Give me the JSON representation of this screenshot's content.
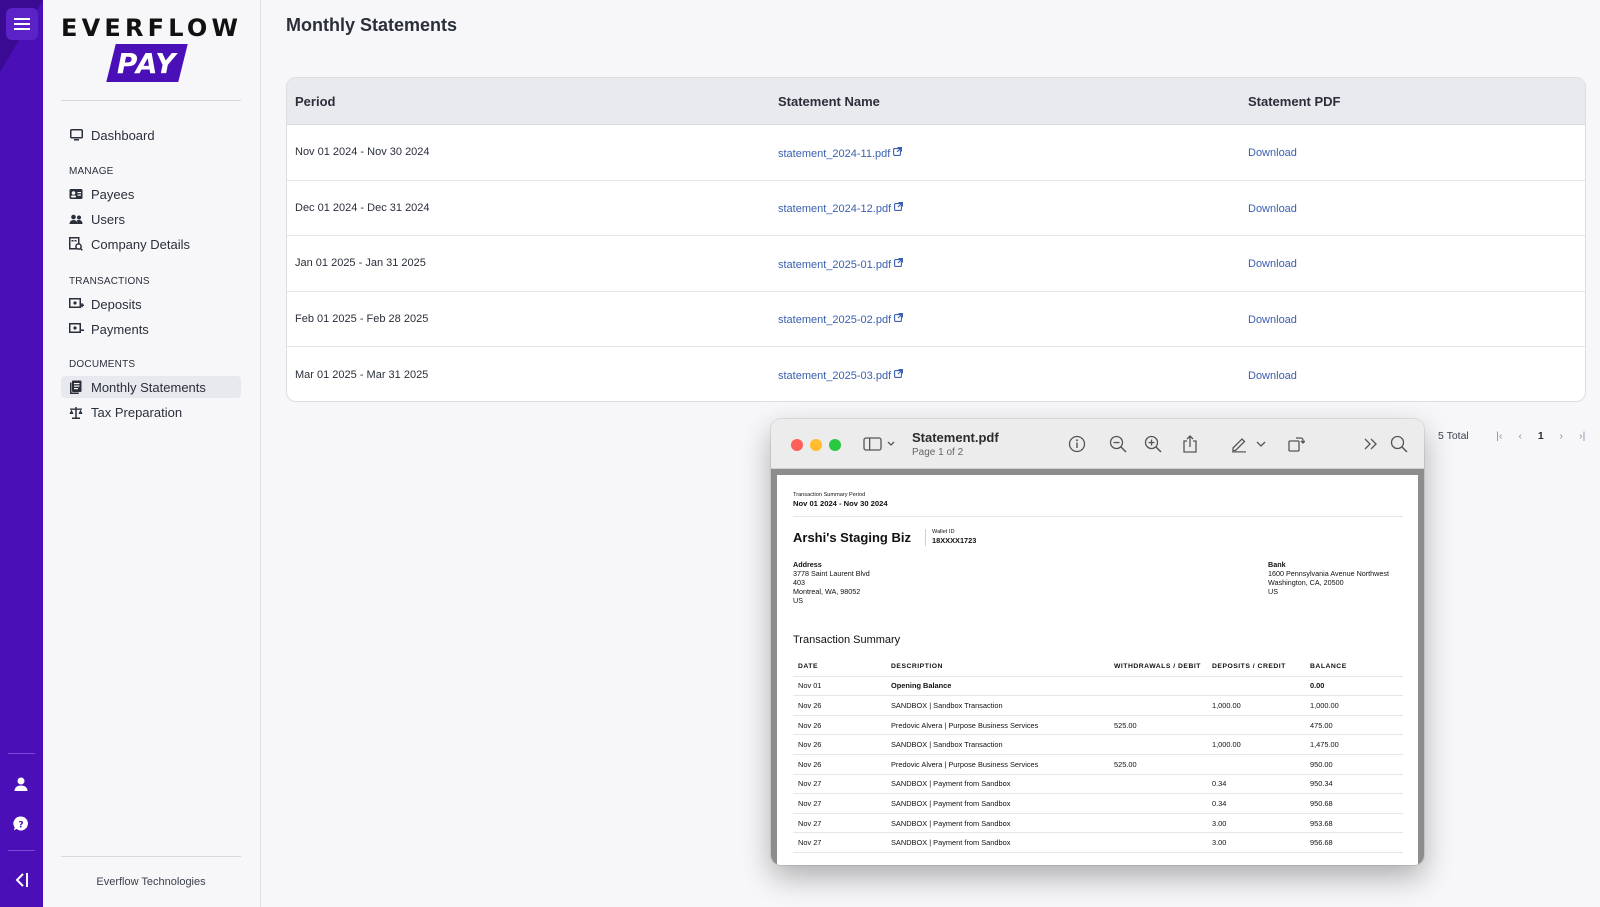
{
  "brand": {
    "word": "EVERFLOW",
    "pay": "PAY",
    "footer": "Everflow Technologies",
    "accent": "#4b0fb8"
  },
  "nav": {
    "dashboard": "Dashboard",
    "sections": {
      "manage": "MANAGE",
      "transactions": "TRANSACTIONS",
      "documents": "DOCUMENTS"
    },
    "payees": "Payees",
    "users": "Users",
    "company_details": "Company Details",
    "deposits": "Deposits",
    "payments": "Payments",
    "monthly_statements": "Monthly Statements",
    "tax_preparation": "Tax Preparation"
  },
  "page": {
    "title": "Monthly Statements"
  },
  "table": {
    "headers": [
      "Period",
      "Statement Name",
      "Statement PDF"
    ],
    "rows": [
      {
        "period": "Nov 01 2024 - Nov 30 2024",
        "name": "statement_2024-11.pdf",
        "action": "Download"
      },
      {
        "period": "Dec 01 2024 - Dec 31 2024",
        "name": "statement_2024-12.pdf",
        "action": "Download"
      },
      {
        "period": "Jan 01 2025 - Jan 31 2025",
        "name": "statement_2025-01.pdf",
        "action": "Download"
      },
      {
        "period": "Feb 01 2025 - Feb 28 2025",
        "name": "statement_2025-02.pdf",
        "action": "Download"
      },
      {
        "period": "Mar 01 2025 - Mar 31 2025",
        "name": "statement_2025-03.pdf",
        "action": "Download"
      }
    ]
  },
  "pagination": {
    "total": "5 Total",
    "first": "|‹",
    "prev": "‹",
    "page": "1",
    "next": "›",
    "last": "›|"
  },
  "pdf_viewer": {
    "filename": "Statement.pdf",
    "page_info": "Page 1 of 2",
    "doc": {
      "period_label": "Transaction Summary Period",
      "period": "Nov 01 2024 - Nov 30 2024",
      "business": "Arshi's Staging Biz",
      "wallet_label": "Wallet ID",
      "wallet_id": "18XXXX1723",
      "address_label": "Address",
      "address": [
        "3778 Saint Laurent Blvd",
        "403",
        "Montreal, WA, 98052",
        "US"
      ],
      "bank_label": "Bank",
      "bank": [
        "1600 Pennsylvania Avenue Northwest",
        "Washington, CA, 20500",
        "US"
      ],
      "summary_title": "Transaction Summary",
      "columns": [
        "DATE",
        "DESCRIPTION",
        "WITHDRAWALS / DEBIT",
        "DEPOSITS / CREDIT",
        "BALANCE"
      ],
      "rows": [
        [
          "Nov 01",
          "Opening Balance",
          "",
          "",
          "0.00"
        ],
        [
          "Nov 26",
          "SANDBOX | Sandbox Transaction",
          "",
          "1,000.00",
          "1,000.00"
        ],
        [
          "Nov 26",
          "Predovic Alvera | Purpose Business Services",
          "525.00",
          "",
          "475.00"
        ],
        [
          "Nov 26",
          "SANDBOX | Sandbox Transaction",
          "",
          "1,000.00",
          "1,475.00"
        ],
        [
          "Nov 26",
          "Predovic Alvera | Purpose Business Services",
          "525.00",
          "",
          "950.00"
        ],
        [
          "Nov 27",
          "SANDBOX | Payment from Sandbox",
          "",
          "0.34",
          "950.34"
        ],
        [
          "Nov 27",
          "SANDBOX | Payment from Sandbox",
          "",
          "0.34",
          "950.68"
        ],
        [
          "Nov 27",
          "SANDBOX | Payment from Sandbox",
          "",
          "3.00",
          "953.68"
        ],
        [
          "Nov 27",
          "SANDBOX | Payment from Sandbox",
          "",
          "3.00",
          "956.68"
        ]
      ]
    }
  }
}
